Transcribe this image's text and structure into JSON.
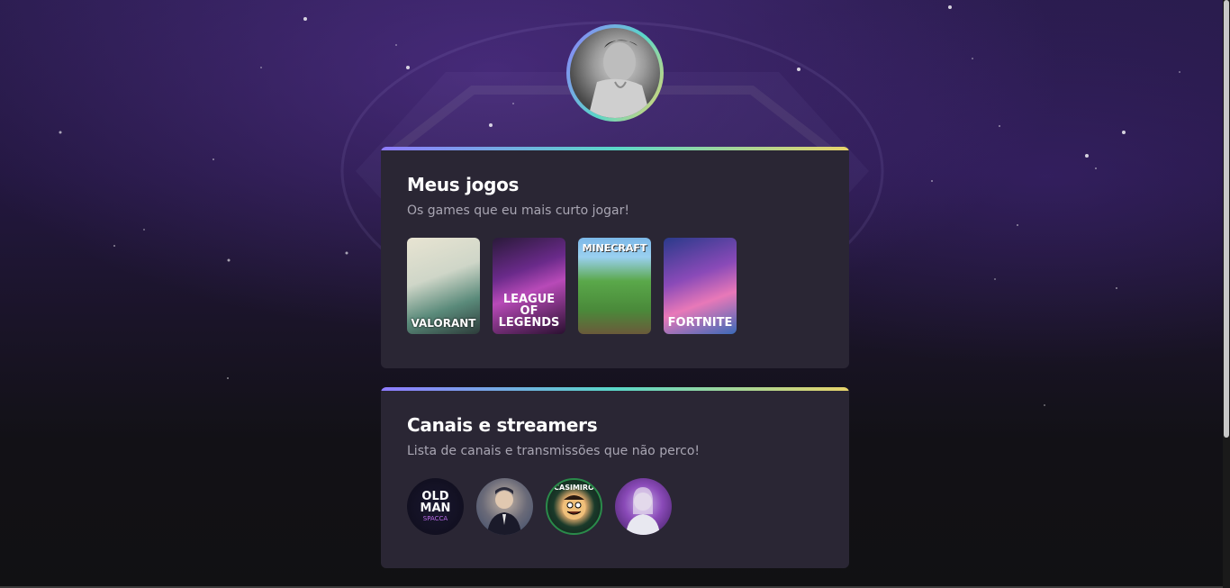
{
  "profile": {
    "avatar_icon": "user-photo"
  },
  "games_card": {
    "title": "Meus jogos",
    "subtitle": "Os games que eu mais curto jogar!",
    "games": [
      {
        "label": "VALORANT"
      },
      {
        "label": "LEAGUE OF LEGENDS"
      },
      {
        "label": "MINECRAFT"
      },
      {
        "label": "FORTNITE"
      }
    ]
  },
  "streams_card": {
    "title": "Canais e streamers",
    "subtitle": "Lista de canais e transmissões que não perco!",
    "channels": [
      {
        "label": "OLD MAN",
        "sublabel": "SPACCA"
      },
      {
        "label": ""
      },
      {
        "label": "CASIMIRO"
      },
      {
        "label": ""
      }
    ]
  },
  "colors": {
    "accent_gradient": [
      "#8f7bff",
      "#5ad7c8",
      "#e8d36a"
    ],
    "card_bg": "#2a2634",
    "subtitle": "#a9a6b3"
  }
}
